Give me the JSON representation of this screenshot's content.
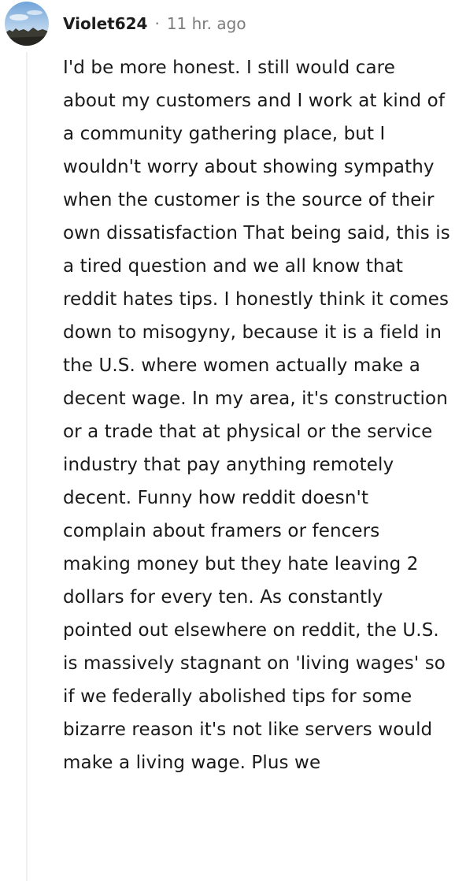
{
  "comment": {
    "author": "Violet624",
    "separator": "·",
    "timestamp": "11 hr. ago",
    "avatar_icon": "user-avatar-landscape",
    "body": "I'd be more honest. I still would care about my customers and I work at kind of a community gathering place, but I wouldn't worry about showing sympathy when the customer is the source of their own dissatisfaction That being said, this is a tired question and we all know that reddit hates tips. I honestly think it comes down to misogyny, because it is a field in the U.S. where women actually make a decent wage. In my area, it's construction or a trade that at physical or the service industry that pay anything remotely decent. Funny how reddit doesn't complain about framers or fencers making money but they hate leaving 2 dollars for every ten. As constantly pointed out elsewhere on reddit, the U.S. is massively stagnant on 'living wages' so if we federally abolished tips for some bizarre reason it's not like servers would make a living wage. Plus we"
  }
}
